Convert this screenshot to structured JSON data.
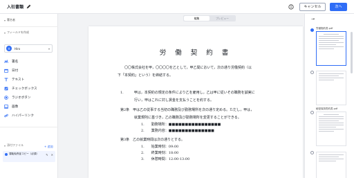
{
  "header": {
    "title": "入社書類",
    "cancel_label": "キャンセル",
    "next_label": "次へ"
  },
  "sidebar": {
    "signer_section": "署名者",
    "fields_section": "フィールドを作成",
    "signer_name": "Hiro",
    "signer_initial": "H",
    "tools": [
      {
        "label": "署名",
        "icon": "signature-icon"
      },
      {
        "label": "日付",
        "icon": "calendar-icon"
      },
      {
        "label": "テキスト",
        "icon": "text-icon"
      },
      {
        "label": "チェックボックス",
        "icon": "checkbox-icon"
      },
      {
        "label": "ラジオボタン",
        "icon": "radio-icon"
      },
      {
        "label": "画像",
        "icon": "image-icon"
      },
      {
        "label": "ハイパーリンク",
        "icon": "link-icon"
      }
    ],
    "attachments_section": "添付ファイル",
    "add_label": "+ 追加",
    "attachment_name": "運転免許証コピー（必須）"
  },
  "main": {
    "tabs": [
      "編集",
      "プレビュー"
    ],
    "document": {
      "title": "労 働 契 約 書",
      "lines": [
        "〇〇株式会社を甲，〇〇〇〇を乙として，甲乙間において，次の通り労働契約（以",
        "下「本契約」という）を締結する。",
        "1.　　　甲は，本契約の規定の条件により乙を雇用し，乙は甲に従いその職務を誠実に",
        "　　　　行い，甲はこれに対し賃金を支払うことを約する。",
        "第2条　甲は乙の従事する当初の職務及び勤務場所を次の通り定める。ただし，甲は，",
        "　　　　就業規則に基づき，乙の職務及び勤務場所を変更することができる。",
        "1.　　勤務場所：■■■■■■■■■■■■■■■■",
        "2.　　業務内容：■■■■■■■■■■■■■■",
        "第3条　乙の就業時間は次の通りとする。",
        "1.　　始業時刻：09:00",
        "2.　　終業時刻：18:00",
        "3.　　休憩時間：12:00-13:00"
      ]
    }
  },
  "panel": {
    "pages": [
      {
        "label": "労働契約書.pdf",
        "selected": true
      },
      {
        "label": "",
        "selected": false
      },
      {
        "label": "秘密保持誓約書.pdf",
        "selected": false
      },
      {
        "label": "",
        "selected": false
      }
    ]
  },
  "colors": {
    "accent": "#2f6df6"
  }
}
